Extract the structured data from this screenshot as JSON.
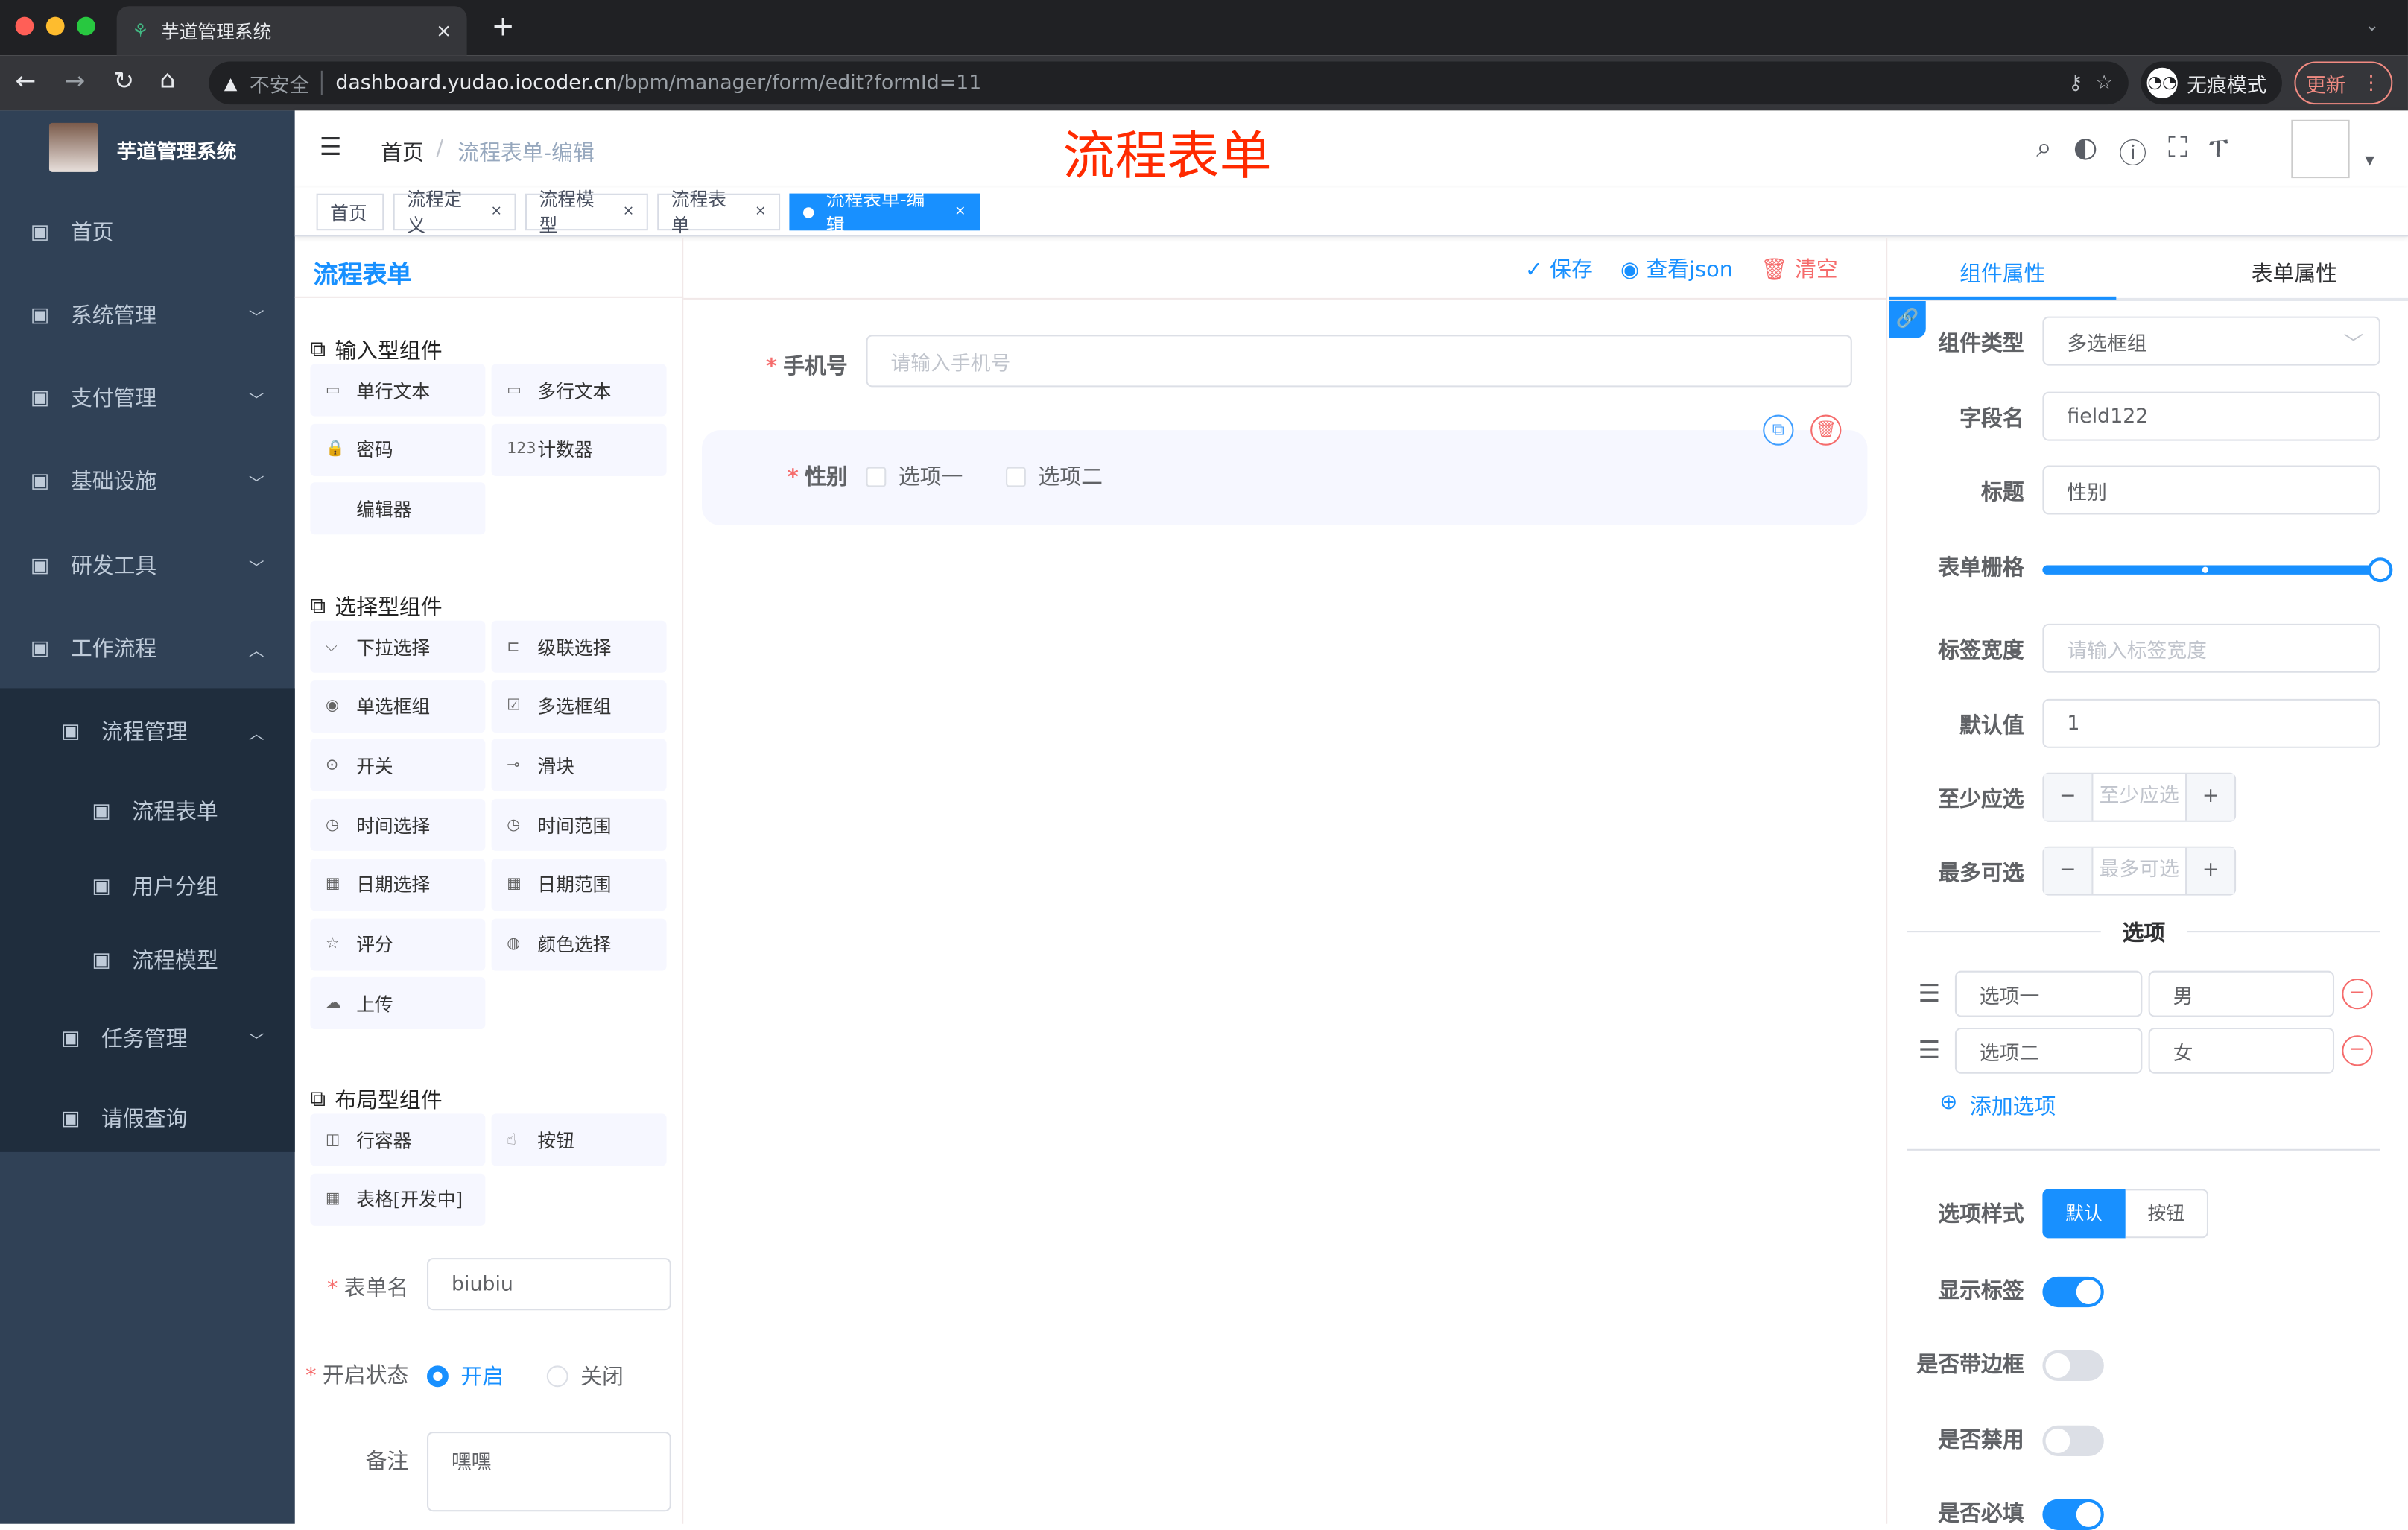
{
  "browser": {
    "tab_title": "芋道管理系统",
    "tab_close": "×",
    "new_tab": "+",
    "security": "不安全",
    "url_host": "dashboard.yudao.iocoder.cn",
    "url_path": "/bpm/manager/form/edit?formId=11",
    "incognito": "无痕模式",
    "update": "更新"
  },
  "sidebar": {
    "app_name": "芋道管理系统",
    "items": [
      {
        "label": "首页",
        "icon": "dashboard-icon",
        "chevron": ""
      },
      {
        "label": "系统管理",
        "icon": "gear-icon",
        "chevron": "﹀"
      },
      {
        "label": "支付管理",
        "icon": "yen-icon",
        "chevron": "﹀"
      },
      {
        "label": "基础设施",
        "icon": "monitor-icon",
        "chevron": "﹀"
      },
      {
        "label": "研发工具",
        "icon": "toolbox-icon",
        "chevron": "﹀"
      },
      {
        "label": "工作流程",
        "icon": "toolbox-icon",
        "chevron": "︿"
      },
      {
        "label": "流程管理",
        "icon": "tree-list-icon",
        "chevron": "︿"
      },
      {
        "label": "流程表单",
        "icon": "form-icon",
        "chevron": ""
      },
      {
        "label": "用户分组",
        "icon": "user-group-icon",
        "chevron": ""
      },
      {
        "label": "流程模型",
        "icon": "send-icon",
        "chevron": ""
      },
      {
        "label": "任务管理",
        "icon": "tree-icon",
        "chevron": "﹀"
      },
      {
        "label": "请假查询",
        "icon": "user-icon",
        "chevron": ""
      }
    ]
  },
  "navbar": {
    "breadcrumb_home": "首页",
    "breadcrumb_sep": "/",
    "breadcrumb_current": "流程表单-编辑",
    "page_heading": "流程表单"
  },
  "tags": [
    {
      "label": "首页",
      "closable": false,
      "active": false
    },
    {
      "label": "流程定义",
      "closable": true,
      "active": false
    },
    {
      "label": "流程模型",
      "closable": true,
      "active": false
    },
    {
      "label": "流程表单",
      "closable": true,
      "active": false
    },
    {
      "label": "流程表单-编辑",
      "closable": true,
      "active": true
    }
  ],
  "left": {
    "title": "流程表单",
    "sections": [
      {
        "title": "输入型组件",
        "items": [
          [
            "单行文本",
            "▭"
          ],
          [
            "多行文本",
            "▭"
          ],
          [
            "密码",
            "🔒"
          ],
          [
            "计数器",
            "123"
          ],
          [
            "编辑器",
            ""
          ]
        ]
      },
      {
        "title": "选择型组件",
        "items": [
          [
            "下拉选择",
            "⌵"
          ],
          [
            "级联选择",
            "⊏"
          ],
          [
            "单选框组",
            "◉"
          ],
          [
            "多选框组",
            "☑"
          ],
          [
            "开关",
            "⊙"
          ],
          [
            "滑块",
            "⊸"
          ],
          [
            "时间选择",
            "◷"
          ],
          [
            "时间范围",
            "◷"
          ],
          [
            "日期选择",
            "▦"
          ],
          [
            "日期范围",
            "▦"
          ],
          [
            "评分",
            "☆"
          ],
          [
            "颜色选择",
            "◍"
          ],
          [
            "上传",
            "☁"
          ]
        ]
      },
      {
        "title": "布局型组件",
        "items": [
          [
            "行容器",
            "◫"
          ],
          [
            "按钮",
            "☝"
          ],
          [
            "表格[开发中]",
            "▦"
          ]
        ]
      }
    ],
    "form": {
      "name_label": "表单名",
      "name_value": "biubiu",
      "status_label": "开启状态",
      "status_on": "开启",
      "status_off": "关闭",
      "status_value": "开启",
      "remark_label": "备注",
      "remark_value": "嘿嘿"
    }
  },
  "toolbar": {
    "save": "保存",
    "view_json": "查看json",
    "clear": "清空"
  },
  "canvas": {
    "phone_label": "手机号",
    "phone_placeholder": "请输入手机号",
    "gender_label": "性别",
    "options": [
      "选项一",
      "选项二"
    ]
  },
  "right": {
    "tab_component": "组件属性",
    "tab_form": "表单属性",
    "type_label": "组件类型",
    "type_value": "多选框组",
    "field_label": "字段名",
    "field_value": "field122",
    "title_label": "标题",
    "title_value": "性别",
    "grid_label": "表单栅格",
    "grid_value": 24,
    "grid_max": 24,
    "label_width_label": "标签宽度",
    "label_width_placeholder": "请输入标签宽度",
    "default_label": "默认值",
    "default_value": "1",
    "min_label": "至少应选",
    "min_placeholder": "至少应选",
    "max_label": "最多可选",
    "max_placeholder": "最多可选",
    "options_divider": "选项",
    "options": [
      {
        "label": "选项一",
        "value": "男"
      },
      {
        "label": "选项二",
        "value": "女"
      }
    ],
    "add_option": "添加选项",
    "style_label": "选项样式",
    "style_default": "默认",
    "style_button": "按钮",
    "show_label": "显示标签",
    "show_label_on": true,
    "border_label": "是否带边框",
    "border_on": false,
    "disabled_label": "是否禁用",
    "disabled_on": false,
    "required_label": "是否必填",
    "required_on": true
  },
  "colors": {
    "primary": "#1890ff",
    "sidebar": "#304156",
    "danger": "#f56c6c",
    "heading": "#ff2a00"
  }
}
